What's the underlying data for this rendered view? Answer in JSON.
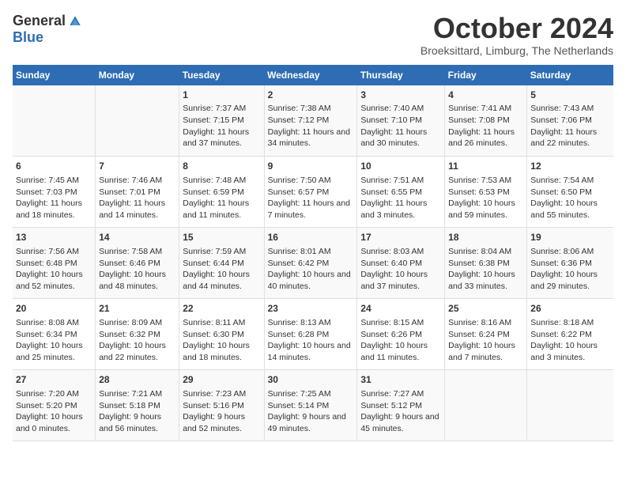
{
  "header": {
    "logo_general": "General",
    "logo_blue": "Blue",
    "month_title": "October 2024",
    "subtitle": "Broeksittard, Limburg, The Netherlands"
  },
  "days_of_week": [
    "Sunday",
    "Monday",
    "Tuesday",
    "Wednesday",
    "Thursday",
    "Friday",
    "Saturday"
  ],
  "weeks": [
    [
      {
        "day": "",
        "info": ""
      },
      {
        "day": "",
        "info": ""
      },
      {
        "day": "1",
        "info": "Sunrise: 7:37 AM\nSunset: 7:15 PM\nDaylight: 11 hours and 37 minutes."
      },
      {
        "day": "2",
        "info": "Sunrise: 7:38 AM\nSunset: 7:12 PM\nDaylight: 11 hours and 34 minutes."
      },
      {
        "day": "3",
        "info": "Sunrise: 7:40 AM\nSunset: 7:10 PM\nDaylight: 11 hours and 30 minutes."
      },
      {
        "day": "4",
        "info": "Sunrise: 7:41 AM\nSunset: 7:08 PM\nDaylight: 11 hours and 26 minutes."
      },
      {
        "day": "5",
        "info": "Sunrise: 7:43 AM\nSunset: 7:06 PM\nDaylight: 11 hours and 22 minutes."
      }
    ],
    [
      {
        "day": "6",
        "info": "Sunrise: 7:45 AM\nSunset: 7:03 PM\nDaylight: 11 hours and 18 minutes."
      },
      {
        "day": "7",
        "info": "Sunrise: 7:46 AM\nSunset: 7:01 PM\nDaylight: 11 hours and 14 minutes."
      },
      {
        "day": "8",
        "info": "Sunrise: 7:48 AM\nSunset: 6:59 PM\nDaylight: 11 hours and 11 minutes."
      },
      {
        "day": "9",
        "info": "Sunrise: 7:50 AM\nSunset: 6:57 PM\nDaylight: 11 hours and 7 minutes."
      },
      {
        "day": "10",
        "info": "Sunrise: 7:51 AM\nSunset: 6:55 PM\nDaylight: 11 hours and 3 minutes."
      },
      {
        "day": "11",
        "info": "Sunrise: 7:53 AM\nSunset: 6:53 PM\nDaylight: 10 hours and 59 minutes."
      },
      {
        "day": "12",
        "info": "Sunrise: 7:54 AM\nSunset: 6:50 PM\nDaylight: 10 hours and 55 minutes."
      }
    ],
    [
      {
        "day": "13",
        "info": "Sunrise: 7:56 AM\nSunset: 6:48 PM\nDaylight: 10 hours and 52 minutes."
      },
      {
        "day": "14",
        "info": "Sunrise: 7:58 AM\nSunset: 6:46 PM\nDaylight: 10 hours and 48 minutes."
      },
      {
        "day": "15",
        "info": "Sunrise: 7:59 AM\nSunset: 6:44 PM\nDaylight: 10 hours and 44 minutes."
      },
      {
        "day": "16",
        "info": "Sunrise: 8:01 AM\nSunset: 6:42 PM\nDaylight: 10 hours and 40 minutes."
      },
      {
        "day": "17",
        "info": "Sunrise: 8:03 AM\nSunset: 6:40 PM\nDaylight: 10 hours and 37 minutes."
      },
      {
        "day": "18",
        "info": "Sunrise: 8:04 AM\nSunset: 6:38 PM\nDaylight: 10 hours and 33 minutes."
      },
      {
        "day": "19",
        "info": "Sunrise: 8:06 AM\nSunset: 6:36 PM\nDaylight: 10 hours and 29 minutes."
      }
    ],
    [
      {
        "day": "20",
        "info": "Sunrise: 8:08 AM\nSunset: 6:34 PM\nDaylight: 10 hours and 25 minutes."
      },
      {
        "day": "21",
        "info": "Sunrise: 8:09 AM\nSunset: 6:32 PM\nDaylight: 10 hours and 22 minutes."
      },
      {
        "day": "22",
        "info": "Sunrise: 8:11 AM\nSunset: 6:30 PM\nDaylight: 10 hours and 18 minutes."
      },
      {
        "day": "23",
        "info": "Sunrise: 8:13 AM\nSunset: 6:28 PM\nDaylight: 10 hours and 14 minutes."
      },
      {
        "day": "24",
        "info": "Sunrise: 8:15 AM\nSunset: 6:26 PM\nDaylight: 10 hours and 11 minutes."
      },
      {
        "day": "25",
        "info": "Sunrise: 8:16 AM\nSunset: 6:24 PM\nDaylight: 10 hours and 7 minutes."
      },
      {
        "day": "26",
        "info": "Sunrise: 8:18 AM\nSunset: 6:22 PM\nDaylight: 10 hours and 3 minutes."
      }
    ],
    [
      {
        "day": "27",
        "info": "Sunrise: 7:20 AM\nSunset: 5:20 PM\nDaylight: 10 hours and 0 minutes."
      },
      {
        "day": "28",
        "info": "Sunrise: 7:21 AM\nSunset: 5:18 PM\nDaylight: 9 hours and 56 minutes."
      },
      {
        "day": "29",
        "info": "Sunrise: 7:23 AM\nSunset: 5:16 PM\nDaylight: 9 hours and 52 minutes."
      },
      {
        "day": "30",
        "info": "Sunrise: 7:25 AM\nSunset: 5:14 PM\nDaylight: 9 hours and 49 minutes."
      },
      {
        "day": "31",
        "info": "Sunrise: 7:27 AM\nSunset: 5:12 PM\nDaylight: 9 hours and 45 minutes."
      },
      {
        "day": "",
        "info": ""
      },
      {
        "day": "",
        "info": ""
      }
    ]
  ]
}
